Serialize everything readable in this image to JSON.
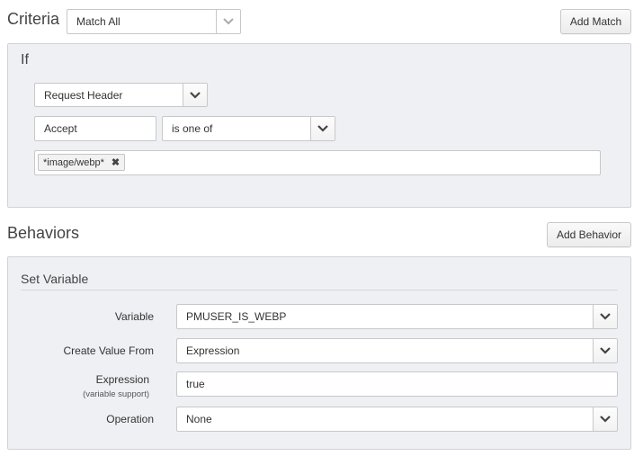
{
  "criteria": {
    "title": "Criteria",
    "match_select": "Match All",
    "add_match_label": "Add Match",
    "if_panel": {
      "title": "If",
      "condition_type": "Request Header",
      "header_name": "Accept",
      "operator": "is one of",
      "values": [
        "*image/webp*"
      ]
    }
  },
  "behaviors": {
    "title": "Behaviors",
    "add_behavior_label": "Add Behavior",
    "set_variable": {
      "title": "Set Variable",
      "variable_label": "Variable",
      "variable_value": "PMUSER_IS_WEBP",
      "create_from_label": "Create Value From",
      "create_from_value": "Expression",
      "expression_label": "Expression",
      "expression_sublabel": "(variable support)",
      "expression_value": "true",
      "operation_label": "Operation",
      "operation_value": "None"
    }
  }
}
